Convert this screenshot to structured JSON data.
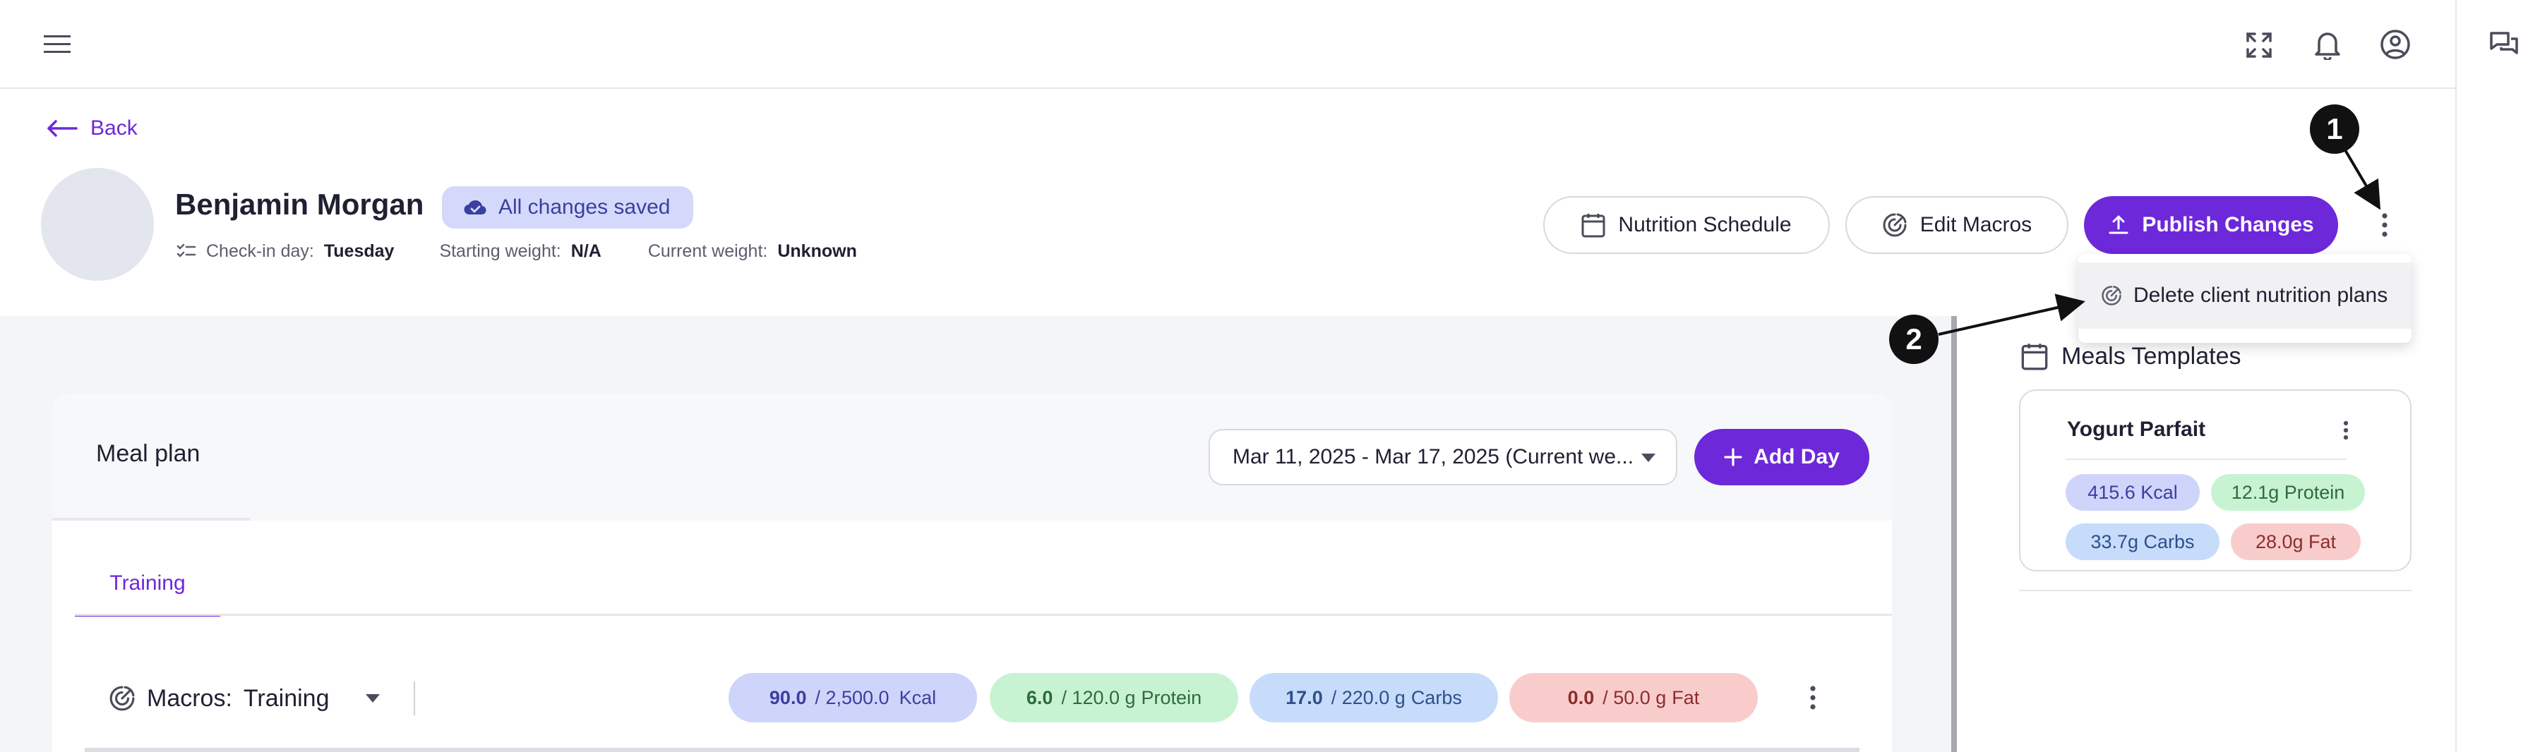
{
  "nav": {
    "back_label": "Back"
  },
  "client": {
    "name": "Benjamin Morgan",
    "save_status": "All changes saved",
    "checkin_label": "Check-in day:",
    "checkin_value": "Tuesday",
    "start_weight_label": "Starting weight:",
    "start_weight_value": "N/A",
    "current_weight_label": "Current weight:",
    "current_weight_value": "Unknown"
  },
  "actions": {
    "nutrition_schedule": "Nutrition Schedule",
    "edit_macros": "Edit Macros",
    "publish_changes": "Publish Changes"
  },
  "menu": {
    "delete_plans": "Delete client nutrition plans"
  },
  "annotations": {
    "marker_1": "1",
    "marker_2": "2"
  },
  "meal_plan": {
    "title": "Meal plan",
    "week_range": "Mar 11, 2025 - Mar 17, 2025 (Current we...",
    "add_day": "Add Day",
    "tabs": [
      "Training"
    ],
    "macros_prefix": "Macros:",
    "macros_value": "Training",
    "pills": [
      {
        "current": "90.0",
        "target": "/ 2,500.0",
        "unit": "Kcal"
      },
      {
        "current": "6.0",
        "target": "/ 120.0 g",
        "unit": "Protein"
      },
      {
        "current": "17.0",
        "target": "/ 220.0 g",
        "unit": "Carbs"
      },
      {
        "current": "0.0",
        "target": "/ 50.0 g",
        "unit": "Fat"
      }
    ]
  },
  "templates": {
    "title": "Meals Templates",
    "items": [
      {
        "name": "Yogurt Parfait",
        "kcal": "415.6 Kcal",
        "protein": "12.1g Protein",
        "carbs": "33.7g Carbs",
        "fat": "28.0g Fat"
      }
    ]
  },
  "colors": {
    "accent": "#6d28d9",
    "kcal_bg": "#cfd4fb",
    "protein_bg": "#c8f3d2",
    "carbs_bg": "#c7dcfb",
    "fat_bg": "#f9cccc"
  }
}
